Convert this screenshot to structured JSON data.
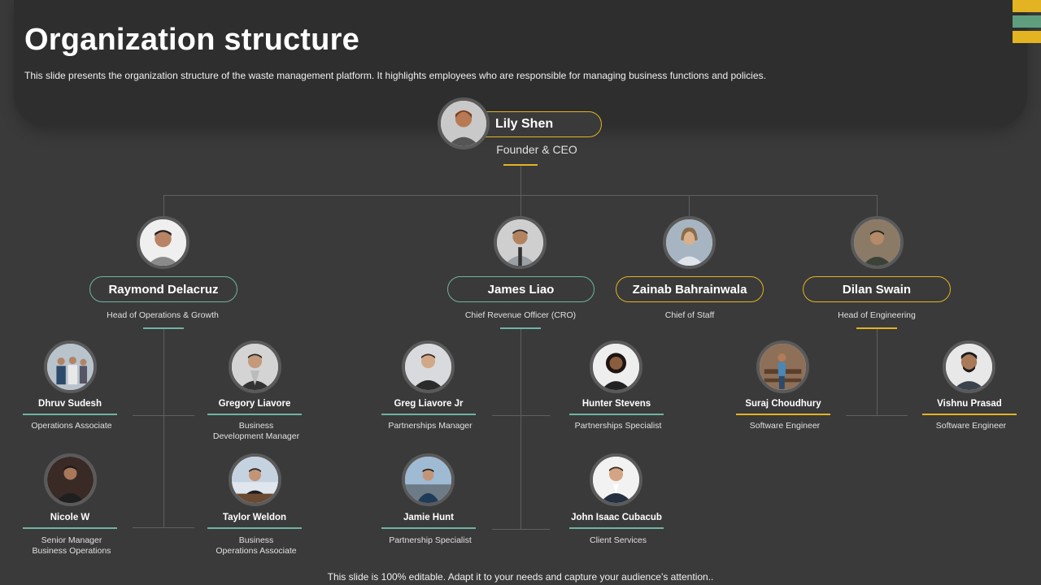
{
  "title": "Organization structure",
  "subtitle": "This slide presents the organization structure of the waste management platform. It highlights employees who are responsible for managing business functions and policies.",
  "footer": "This slide is 100% editable. Adapt it to your needs and capture your audience’s attention..",
  "colors": {
    "accent_teal": "#6fb3a4",
    "accent_gold": "#e3b321",
    "accent_green": "#5e9e7e",
    "background": "#3a3a3a",
    "panel": "#2e2e2e"
  },
  "ceo": {
    "name": "Lily Shen",
    "role": "Founder & CEO",
    "avatar_icon": "person-photo-icon"
  },
  "heads": [
    {
      "name": "Raymond Delacruz",
      "role": "Head of Operations & Growth",
      "accent": "teal"
    },
    {
      "name": "James Liao",
      "role": "Chief Revenue Officer (CRO)",
      "accent": "teal"
    },
    {
      "name": "Zainab Bahrainwala",
      "role": "Chief of Staff",
      "accent": "gold"
    },
    {
      "name": "Dilan Swain",
      "role": "Head of Engineering",
      "accent": "gold"
    }
  ],
  "employees": [
    {
      "name": "Dhruv Sudesh",
      "role": "Operations Associate",
      "accent": "teal"
    },
    {
      "name": "Gregory Liavore",
      "role": "Business\nDevelopment Manager",
      "accent": "teal"
    },
    {
      "name": "Nicole W",
      "role": "Senior Manager\nBusiness Operations",
      "accent": "teal"
    },
    {
      "name": "Taylor Weldon",
      "role": "Business\nOperations Associate",
      "accent": "teal"
    },
    {
      "name": "Greg Liavore Jr",
      "role": "Partnerships Manager",
      "accent": "teal"
    },
    {
      "name": "Hunter Stevens",
      "role": "Partnerships Specialist",
      "accent": "teal"
    },
    {
      "name": "Jamie Hunt",
      "role": "Partnership Specialist",
      "accent": "teal"
    },
    {
      "name": "John Isaac Cubacub",
      "role": "Client Services",
      "accent": "teal"
    },
    {
      "name": "Suraj Choudhury",
      "role": "Software Engineer",
      "accent": "gold"
    },
    {
      "name": "Vishnu Prasad",
      "role": "Software Engineer",
      "accent": "gold"
    }
  ]
}
